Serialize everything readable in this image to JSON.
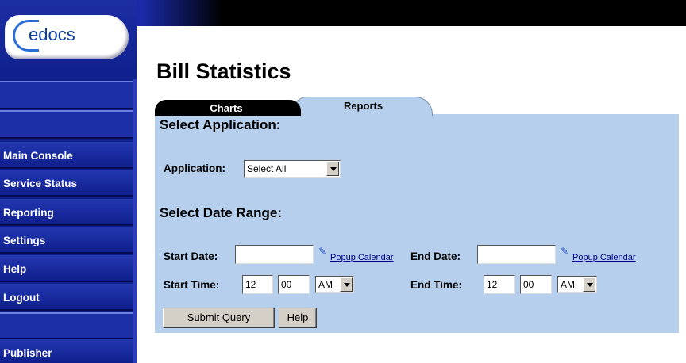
{
  "sidebar": {
    "logo_text": "edocs",
    "nav": [
      {
        "label": "Main Console"
      },
      {
        "label": "Service Status"
      },
      {
        "label": "Reporting"
      },
      {
        "label": "Settings"
      },
      {
        "label": "Help"
      },
      {
        "label": "Logout"
      },
      {
        "label": "Publisher"
      }
    ]
  },
  "page": {
    "title": "Bill Statistics"
  },
  "tabs": [
    {
      "label": "Charts"
    },
    {
      "label": "Reports"
    }
  ],
  "application_section": {
    "heading": "Select Application:",
    "label": "Application:",
    "selected": "Select All"
  },
  "date_section": {
    "heading": "Select Date Range:",
    "start_date_label": "Start Date:",
    "start_date_value": "",
    "end_date_label": "End Date:",
    "end_date_value": "",
    "popup_calendar": "Popup Calendar",
    "start_time_label": "Start Time:",
    "start_hour": "12",
    "start_minute": "00",
    "start_ampm": "AM",
    "end_time_label": "End Time:",
    "end_hour": "12",
    "end_minute": "00",
    "end_ampm": "AM"
  },
  "buttons": {
    "submit": "Submit Query",
    "help": "Help"
  },
  "colors": {
    "sidebar": "#0f1f8c",
    "panel": "#b5cfec",
    "top_band": "#000000",
    "link": "#00008b"
  }
}
